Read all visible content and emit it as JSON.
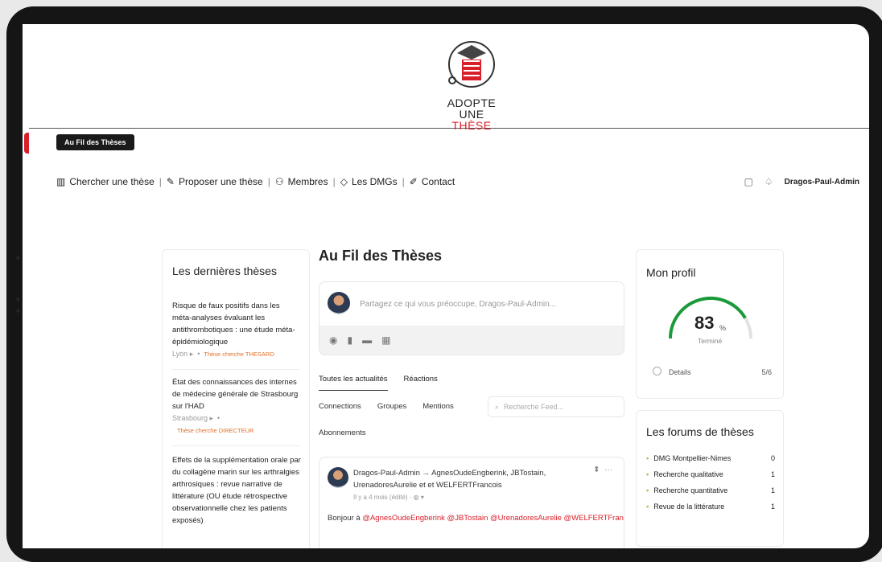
{
  "tooltip": "Au Fil des Thèses",
  "logo": {
    "line1": "ADOPTE",
    "line2a": "UNE ",
    "line2b": "THÈSE"
  },
  "nav": [
    {
      "icon": "books-icon",
      "label": "Chercher une thèse"
    },
    {
      "icon": "pencil-icon",
      "label": "Proposer une thèse"
    },
    {
      "icon": "members-icon",
      "label": "Membres"
    },
    {
      "icon": "graduation-icon",
      "label": "Les DMGs"
    },
    {
      "icon": "pen-icon",
      "label": "Contact"
    }
  ],
  "user": {
    "name": "Dragos-Paul-Admin"
  },
  "latest": {
    "title": "Les dernières thèses",
    "items": [
      {
        "title": "Risque de faux positifs dans les méta-analyses évaluant les antithrombotiques : une étude méta-épidémiologique",
        "city": "Lyon",
        "tag": "Thèse cherche THESARD"
      },
      {
        "title": "État des connaissances des internes de médecine générale de Strasbourg sur l'HAD",
        "city": "Strasbourg",
        "tag": "Thèse cherche DIRECTEUR"
      },
      {
        "title": "Effets de la supplémentation orale par du collagène marin sur les arthralgies arthrosiques : revue narrative de littérature (OU étude rétrospective observationnelle chez les patients exposés)",
        "city": "",
        "tag": ""
      }
    ]
  },
  "feed": {
    "title": "Au Fil des Thèses",
    "composer_placeholder": "Partagez ce qui vous préoccupe, Dragos-Paul-Admin...",
    "tabs": [
      "Toutes les actualités",
      "Réactions"
    ],
    "subtabs": [
      "Connections",
      "Groupes",
      "Mentions"
    ],
    "subtab2": "Abonnements",
    "search_placeholder": "Recherche Feed...",
    "post": {
      "header": "Dragos-Paul-Admin → AgnesOudeEngberink, JBTostain, UrenadoresAurelie et et WELFERTFrancois",
      "meta": "Il y a 4 mois (édité) · ",
      "body_prefix": "Bonjour à ",
      "body_mentions": "@AgnesOudeEngberink @JBTostain @UrenadoresAurelie @WELFERTFran"
    }
  },
  "profile": {
    "title": "Mon profil",
    "percent": 83,
    "percent_label": "83",
    "unit": "%",
    "done": "Terminé",
    "details": "Details",
    "steps": "5/6"
  },
  "forums": {
    "title": "Les forums de thèses",
    "items": [
      {
        "label": "DMG Montpellier-Nimes",
        "count": "0"
      },
      {
        "label": "Recherche qualitative",
        "count": "1"
      },
      {
        "label": "Recherche quantitative",
        "count": "1"
      },
      {
        "label": "Revue de la littérature",
        "count": "1"
      }
    ]
  },
  "colors": {
    "brand_red": "#d8202a",
    "accent_green": "#1a9a3a",
    "tag_orange": "#e0702a"
  }
}
